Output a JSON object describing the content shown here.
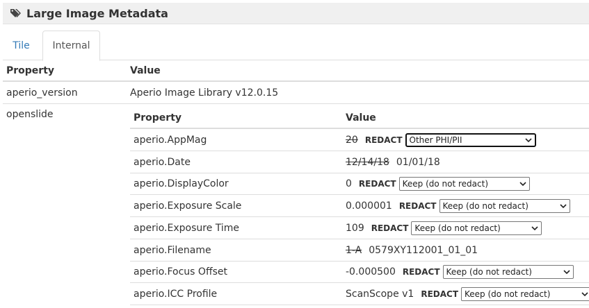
{
  "header": {
    "title": "Large Image Metadata",
    "icon": "tags-icon"
  },
  "tabs": [
    {
      "label": "Tile",
      "active": false
    },
    {
      "label": "Internal",
      "active": true
    }
  ],
  "outer_table": {
    "headers": {
      "property": "Property",
      "value": "Value"
    },
    "rows": [
      {
        "property": "aperio_version",
        "value": "Aperio Image Library v12.0.15"
      },
      {
        "property": "openslide"
      }
    ]
  },
  "inner_table": {
    "headers": {
      "property": "Property",
      "value": "Value"
    },
    "redact_label": "REDACT",
    "rows": [
      {
        "property": "aperio.AppMag",
        "original": "20",
        "original_struck": true,
        "select": "Other PHI/PII"
      },
      {
        "property": "aperio.Date",
        "original": "12/14/18",
        "original_struck": true,
        "replacement": "01/01/18"
      },
      {
        "property": "aperio.DisplayColor",
        "original": "0",
        "select": "Keep (do not redact)"
      },
      {
        "property": "aperio.Exposure Scale",
        "original": "0.000001",
        "select": "Keep (do not redact)"
      },
      {
        "property": "aperio.Exposure Time",
        "original": "109",
        "select": "Keep (do not redact)"
      },
      {
        "property": "aperio.Filename",
        "original": "1-A",
        "original_struck": true,
        "replacement": "0579XY112001_01_01"
      },
      {
        "property": "aperio.Focus Offset",
        "original": "-0.000500",
        "select": "Keep (do not redact)"
      },
      {
        "property": "aperio.ICC Profile",
        "original": "ScanScope v1",
        "select": "Keep (do not redact)"
      }
    ]
  }
}
